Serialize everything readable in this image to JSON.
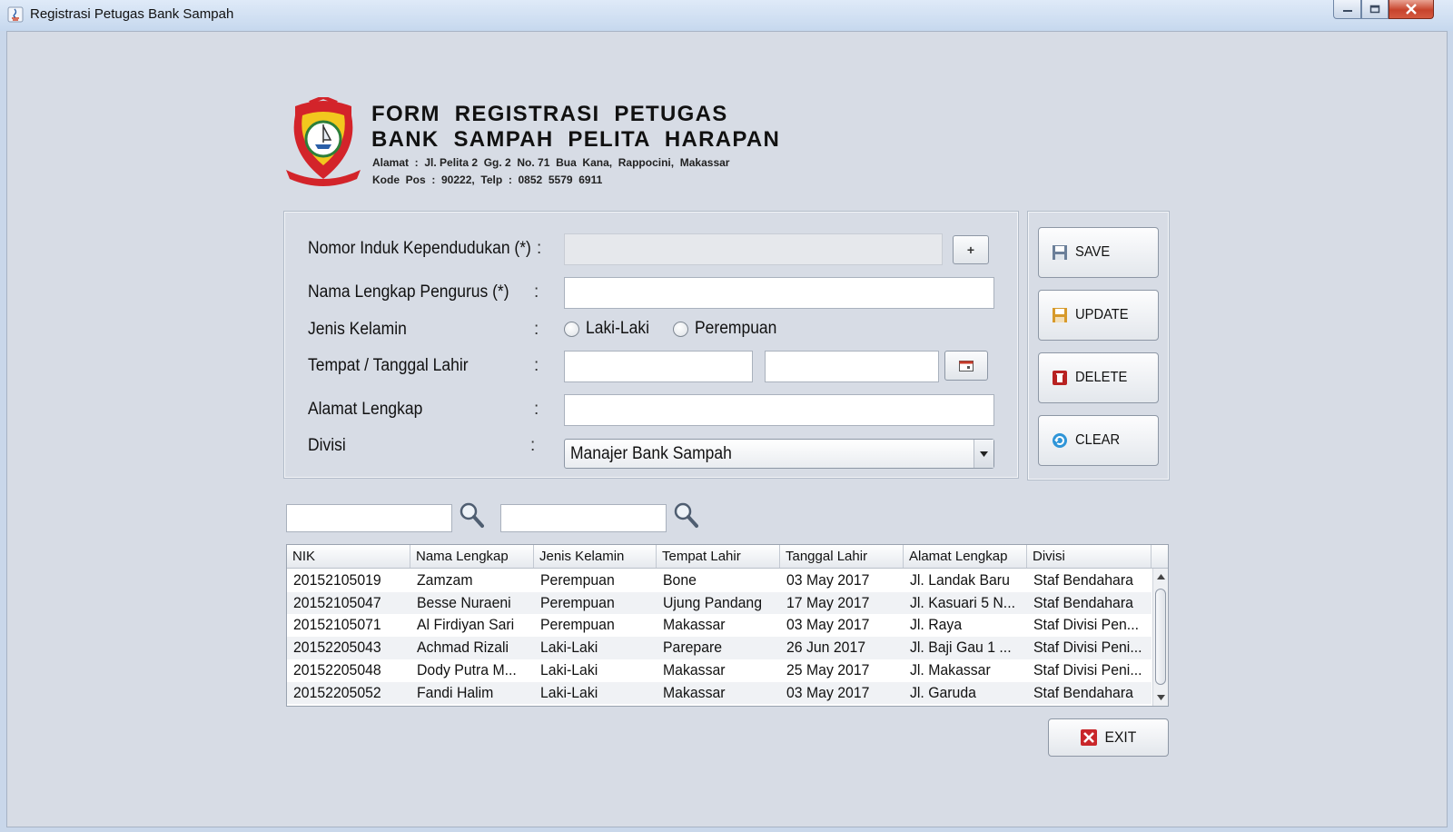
{
  "window": {
    "title": "Registrasi Petugas Bank Sampah",
    "controls": [
      "minimize-icon",
      "maximize-icon",
      "close-icon"
    ]
  },
  "header": {
    "title_line1": "FORM  REGISTRASI  PETUGAS",
    "title_line2": "BANK  SAMPAH  PELITA  HARAPAN",
    "address_line1": "Alamat  :  Jl. Pelita 2  Gg. 2  No. 71  Bua  Kana,  Rappocini,  Makassar",
    "address_line2": "Kode  Pos  :  90222,  Telp  :  0852  5579  6911",
    "logo_icon": "city-emblem-icon"
  },
  "form": {
    "colon": ":",
    "nik_label": "Nomor Induk Kependudukan (*)",
    "nik_value": "",
    "nik_add_label": "+",
    "nama_label": "Nama Lengkap Pengurus (*)",
    "nama_value": "",
    "gender_label": "Jenis Kelamin",
    "gender_options": [
      "Laki-Laki",
      "Perempuan"
    ],
    "ttl_label": "Tempat  / Tanggal Lahir",
    "tempat_value": "",
    "tanggal_value": "",
    "alamat_label": "Alamat Lengkap",
    "alamat_value": "",
    "divisi_label": "Divisi",
    "divisi_selected": "Manajer Bank Sampah"
  },
  "actions": {
    "save": "SAVE",
    "update": "UPDATE",
    "delete": "DELETE",
    "clear": "CLEAR",
    "exit": "EXIT"
  },
  "search": {
    "field1_value": "",
    "field2_value": ""
  },
  "table": {
    "columns": [
      "NIK",
      "Nama Lengkap",
      "Jenis Kelamin",
      "Tempat Lahir",
      "Tanggal Lahir",
      "Alamat Lengkap",
      "Divisi"
    ],
    "rows": [
      [
        "20152105019",
        "Zamzam",
        "Perempuan",
        "Bone",
        "03 May 2017",
        "Jl. Landak Baru",
        "Staf Bendahara"
      ],
      [
        "20152105047",
        "Besse Nuraeni",
        "Perempuan",
        "Ujung Pandang",
        "17 May 2017",
        "Jl. Kasuari 5 N...",
        "Staf Bendahara"
      ],
      [
        "20152105071",
        "Al Firdiyan Sari",
        "Perempuan",
        "Makassar",
        "03 May 2017",
        "Jl. Raya",
        "Staf Divisi Pen..."
      ],
      [
        "20152205043",
        "Achmad Rizali",
        "Laki-Laki",
        "Parepare",
        "26 Jun 2017",
        "Jl. Baji Gau 1 ...",
        "Staf Divisi Peni..."
      ],
      [
        "20152205048",
        "Dody Putra M...",
        "Laki-Laki",
        "Makassar",
        "25 May 2017",
        "Jl. Makassar",
        "Staf Divisi Peni..."
      ],
      [
        "20152205052",
        "Fandi Halim",
        "Laki-Laki",
        "Makassar",
        "03 May 2017",
        "Jl. Garuda",
        "Staf Bendahara"
      ]
    ]
  }
}
